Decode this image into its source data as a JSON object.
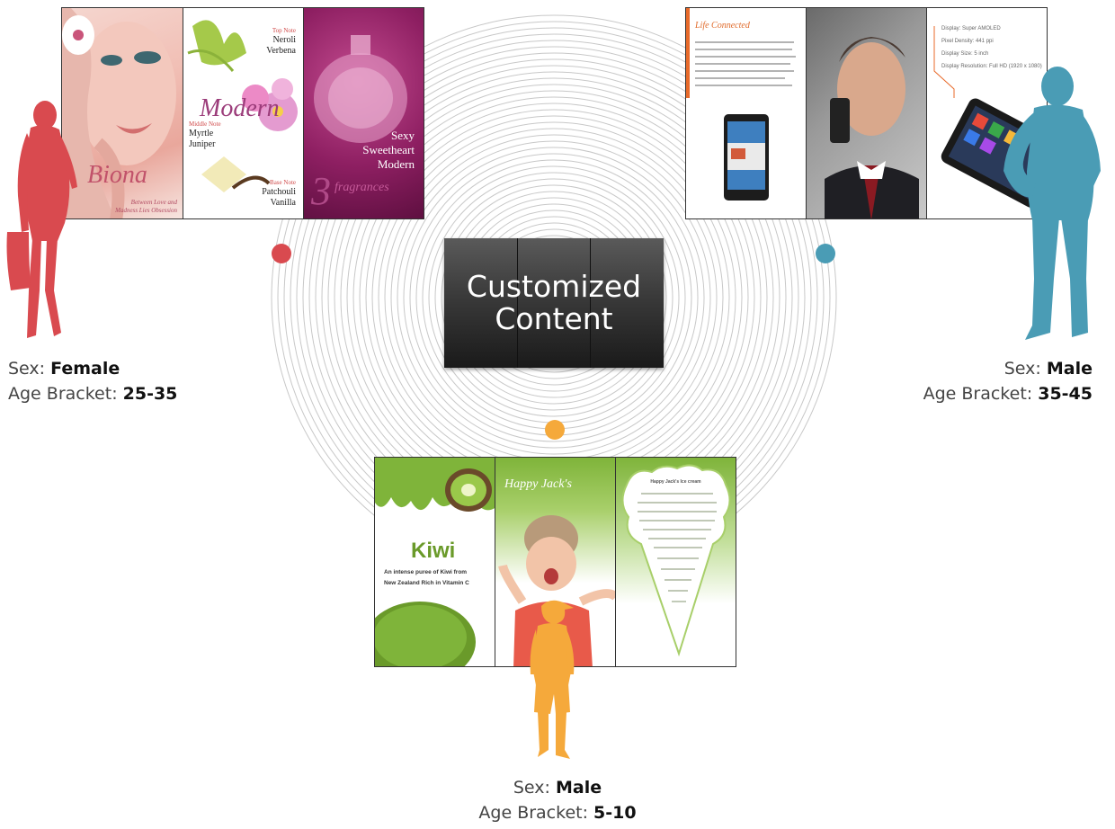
{
  "center": {
    "line1": "Customized",
    "line2": "Content"
  },
  "segments": [
    {
      "id": "female",
      "color": "#d94a4f",
      "sex_label": "Sex: ",
      "sex": "Female",
      "age_label": "Age Bracket: ",
      "age": "25-35",
      "panels": {
        "p1": {
          "title": "Biona",
          "tagline1": "Between Love and",
          "tagline2": "Madness Lies Obsession"
        },
        "p2": {
          "script": "Modern",
          "top_note_label": "Top Note",
          "top_note_1": "Neroli",
          "top_note_2": "Verbena",
          "middle_note_label": "Middle Note",
          "middle_note_1": "Myrtle",
          "middle_note_2": "Juniper",
          "base_note_label": "Base Note",
          "base_note_1": "Patchouli",
          "base_note_2": "Vanilla"
        },
        "p3": {
          "line1": "Sexy",
          "line2": "Sweetheart",
          "line3": "Modern",
          "count": "3",
          "script": "fragrances"
        }
      }
    },
    {
      "id": "male-adult",
      "color": "#4a9cb5",
      "sex_label": "Sex: ",
      "sex": "Male",
      "age_label": "Age Bracket: ",
      "age": "35-45",
      "panels": {
        "p1": {
          "script": "Life Connected"
        },
        "p3": {
          "spec1": "Display: Super AMOLED",
          "spec2": "Pixel Density: 441 ppi",
          "spec3": "Display Size: 5 inch",
          "spec4": "Display Resolution: Full HD (1920 x 1080)"
        }
      }
    },
    {
      "id": "male-child",
      "color": "#f5a93b",
      "sex_label": "Sex: ",
      "sex": "Male",
      "age_label": "Age Bracket: ",
      "age": "5-10",
      "panels": {
        "p1": {
          "title": "Kiwi",
          "desc1": "An intense puree of Kiwi from",
          "desc2": "New Zealand Rich in Vitamin C"
        },
        "p2": {
          "script": "Happy Jack's"
        },
        "p3": {
          "heading": "Happy Jack's Ice cream"
        }
      }
    }
  ],
  "colors": {
    "ring": "#c8c8c8",
    "center_bg": "#2c2c2c"
  }
}
